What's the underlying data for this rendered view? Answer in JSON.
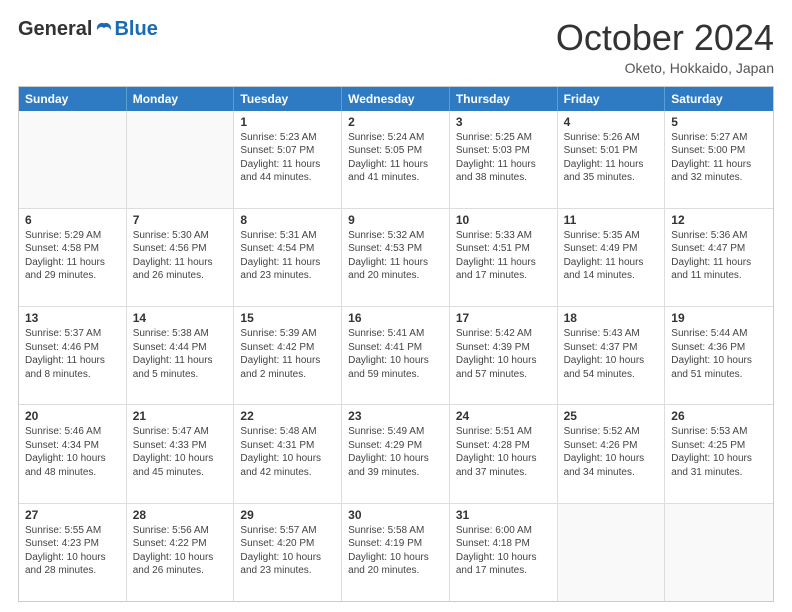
{
  "header": {
    "logo_general": "General",
    "logo_blue": "Blue",
    "month_title": "October 2024",
    "location": "Oketo, Hokkaido, Japan"
  },
  "calendar": {
    "days_of_week": [
      "Sunday",
      "Monday",
      "Tuesday",
      "Wednesday",
      "Thursday",
      "Friday",
      "Saturday"
    ],
    "rows": [
      [
        {
          "day": "",
          "info": ""
        },
        {
          "day": "",
          "info": ""
        },
        {
          "day": "1",
          "info": "Sunrise: 5:23 AM\nSunset: 5:07 PM\nDaylight: 11 hours and 44 minutes."
        },
        {
          "day": "2",
          "info": "Sunrise: 5:24 AM\nSunset: 5:05 PM\nDaylight: 11 hours and 41 minutes."
        },
        {
          "day": "3",
          "info": "Sunrise: 5:25 AM\nSunset: 5:03 PM\nDaylight: 11 hours and 38 minutes."
        },
        {
          "day": "4",
          "info": "Sunrise: 5:26 AM\nSunset: 5:01 PM\nDaylight: 11 hours and 35 minutes."
        },
        {
          "day": "5",
          "info": "Sunrise: 5:27 AM\nSunset: 5:00 PM\nDaylight: 11 hours and 32 minutes."
        }
      ],
      [
        {
          "day": "6",
          "info": "Sunrise: 5:29 AM\nSunset: 4:58 PM\nDaylight: 11 hours and 29 minutes."
        },
        {
          "day": "7",
          "info": "Sunrise: 5:30 AM\nSunset: 4:56 PM\nDaylight: 11 hours and 26 minutes."
        },
        {
          "day": "8",
          "info": "Sunrise: 5:31 AM\nSunset: 4:54 PM\nDaylight: 11 hours and 23 minutes."
        },
        {
          "day": "9",
          "info": "Sunrise: 5:32 AM\nSunset: 4:53 PM\nDaylight: 11 hours and 20 minutes."
        },
        {
          "day": "10",
          "info": "Sunrise: 5:33 AM\nSunset: 4:51 PM\nDaylight: 11 hours and 17 minutes."
        },
        {
          "day": "11",
          "info": "Sunrise: 5:35 AM\nSunset: 4:49 PM\nDaylight: 11 hours and 14 minutes."
        },
        {
          "day": "12",
          "info": "Sunrise: 5:36 AM\nSunset: 4:47 PM\nDaylight: 11 hours and 11 minutes."
        }
      ],
      [
        {
          "day": "13",
          "info": "Sunrise: 5:37 AM\nSunset: 4:46 PM\nDaylight: 11 hours and 8 minutes."
        },
        {
          "day": "14",
          "info": "Sunrise: 5:38 AM\nSunset: 4:44 PM\nDaylight: 11 hours and 5 minutes."
        },
        {
          "day": "15",
          "info": "Sunrise: 5:39 AM\nSunset: 4:42 PM\nDaylight: 11 hours and 2 minutes."
        },
        {
          "day": "16",
          "info": "Sunrise: 5:41 AM\nSunset: 4:41 PM\nDaylight: 10 hours and 59 minutes."
        },
        {
          "day": "17",
          "info": "Sunrise: 5:42 AM\nSunset: 4:39 PM\nDaylight: 10 hours and 57 minutes."
        },
        {
          "day": "18",
          "info": "Sunrise: 5:43 AM\nSunset: 4:37 PM\nDaylight: 10 hours and 54 minutes."
        },
        {
          "day": "19",
          "info": "Sunrise: 5:44 AM\nSunset: 4:36 PM\nDaylight: 10 hours and 51 minutes."
        }
      ],
      [
        {
          "day": "20",
          "info": "Sunrise: 5:46 AM\nSunset: 4:34 PM\nDaylight: 10 hours and 48 minutes."
        },
        {
          "day": "21",
          "info": "Sunrise: 5:47 AM\nSunset: 4:33 PM\nDaylight: 10 hours and 45 minutes."
        },
        {
          "day": "22",
          "info": "Sunrise: 5:48 AM\nSunset: 4:31 PM\nDaylight: 10 hours and 42 minutes."
        },
        {
          "day": "23",
          "info": "Sunrise: 5:49 AM\nSunset: 4:29 PM\nDaylight: 10 hours and 39 minutes."
        },
        {
          "day": "24",
          "info": "Sunrise: 5:51 AM\nSunset: 4:28 PM\nDaylight: 10 hours and 37 minutes."
        },
        {
          "day": "25",
          "info": "Sunrise: 5:52 AM\nSunset: 4:26 PM\nDaylight: 10 hours and 34 minutes."
        },
        {
          "day": "26",
          "info": "Sunrise: 5:53 AM\nSunset: 4:25 PM\nDaylight: 10 hours and 31 minutes."
        }
      ],
      [
        {
          "day": "27",
          "info": "Sunrise: 5:55 AM\nSunset: 4:23 PM\nDaylight: 10 hours and 28 minutes."
        },
        {
          "day": "28",
          "info": "Sunrise: 5:56 AM\nSunset: 4:22 PM\nDaylight: 10 hours and 26 minutes."
        },
        {
          "day": "29",
          "info": "Sunrise: 5:57 AM\nSunset: 4:20 PM\nDaylight: 10 hours and 23 minutes."
        },
        {
          "day": "30",
          "info": "Sunrise: 5:58 AM\nSunset: 4:19 PM\nDaylight: 10 hours and 20 minutes."
        },
        {
          "day": "31",
          "info": "Sunrise: 6:00 AM\nSunset: 4:18 PM\nDaylight: 10 hours and 17 minutes."
        },
        {
          "day": "",
          "info": ""
        },
        {
          "day": "",
          "info": ""
        }
      ]
    ]
  }
}
